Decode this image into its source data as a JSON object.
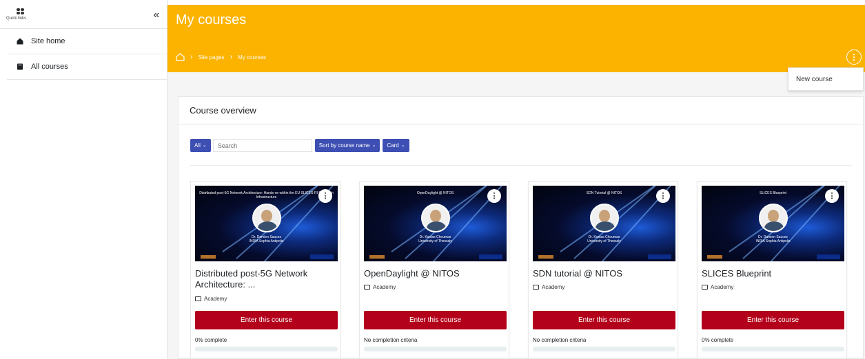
{
  "sidebar": {
    "quick_links_label": "Quick links",
    "collapse_glyph": "«",
    "items": [
      {
        "label": "Site home",
        "icon": "home-icon"
      },
      {
        "label": "All courses",
        "icon": "book-icon"
      }
    ]
  },
  "header": {
    "title": "My courses",
    "breadcrumb": [
      "Site pages",
      "My courses"
    ],
    "menu_glyph": "⋮"
  },
  "dropdown": {
    "items": [
      "New course"
    ]
  },
  "overview": {
    "title": "Course overview",
    "filter_all": "All",
    "search_placeholder": "Search",
    "sort_label": "Sort by course name",
    "view_label": "Card"
  },
  "courses": [
    {
      "name": "Distributed post-5G Network Architecture: ...",
      "category": "Academy",
      "button": "Enter this course",
      "progress_text": "0% complete",
      "progress_percent": 0,
      "thumb_title": "Distributed post-5G Network Architecture: Hands-on within the EU SLICES-RI Research Infrastructure",
      "thumb_speaker": "Dr. Damien Saucez",
      "thumb_affiliation": "INRIA Sophia Antipolis"
    },
    {
      "name": "OpenDaylight @ NITOS",
      "category": "Academy",
      "button": "Enter this course",
      "progress_text": "No completion criteria",
      "progress_percent": null,
      "thumb_title": "OpenDaylight @ NITOS",
      "thumb_speaker": "Dr. Kostas Choumas",
      "thumb_affiliation": "University of Thessaly"
    },
    {
      "name": "SDN tutorial @ NITOS",
      "category": "Academy",
      "button": "Enter this course",
      "progress_text": "No completion criteria",
      "progress_percent": null,
      "thumb_title": "SDN Tutorial @ NITOS",
      "thumb_speaker": "Dr. Kostas Choumas",
      "thumb_affiliation": "University of Thessaly"
    },
    {
      "name": "SLICES Blueprint",
      "category": "Academy",
      "button": "Enter this course",
      "progress_text": "0% complete",
      "progress_percent": 0,
      "thumb_title": "SLICES Blueprint",
      "thumb_speaker": "Dr. Damien Saucez",
      "thumb_affiliation": "INRIA Sophia Antipolis"
    }
  ],
  "colors": {
    "header_bg": "#fbb300",
    "primary_button": "#3d4fb3",
    "enter_button": "#b3001b"
  }
}
